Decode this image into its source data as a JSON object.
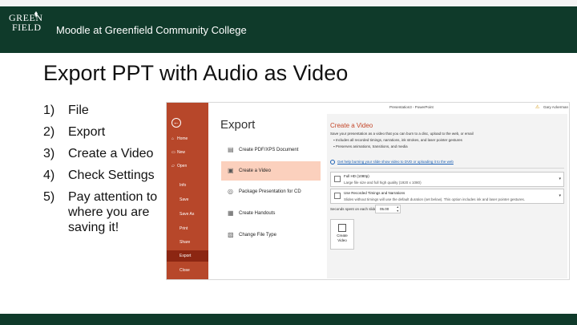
{
  "header": {
    "logo_top": "GREEN",
    "logo_bottom": "FIELD",
    "org_name": "Moodle at Greenfield Community College"
  },
  "slide": {
    "title": "Export PPT with Audio as Video",
    "steps": [
      {
        "num": "1)",
        "text": "File"
      },
      {
        "num": "2)",
        "text": "Export"
      },
      {
        "num": "3)",
        "text": "Create a Video"
      },
      {
        "num": "4)",
        "text": "Check Settings"
      },
      {
        "num": "5)",
        "text": "Pay attention to where you are saving it!"
      }
    ]
  },
  "ppt": {
    "app_title": "Presentation3 - PowerPoint",
    "user_name": "Gary Ackerman",
    "sidebar": [
      {
        "label": "Home",
        "icon": "⌂"
      },
      {
        "label": "New",
        "icon": "▭"
      },
      {
        "label": "Open",
        "icon": "▱"
      },
      {
        "label": "Info"
      },
      {
        "label": "Save"
      },
      {
        "label": "Save As"
      },
      {
        "label": "Print"
      },
      {
        "label": "Share"
      },
      {
        "label": "Export"
      },
      {
        "label": "Close"
      }
    ],
    "export_heading": "Export",
    "options": [
      {
        "label": "Create PDF/XPS Document",
        "icon": "▤"
      },
      {
        "label": "Create a Video",
        "icon": "▣"
      },
      {
        "label": "Package Presentation for CD",
        "icon": "◎"
      },
      {
        "label": "Create Handouts",
        "icon": "▦"
      },
      {
        "label": "Change File Type",
        "icon": "▧"
      }
    ],
    "detail": {
      "title": "Create a Video",
      "description": "Save your presentation as a video that you can burn to a disc, upload to the web, or email",
      "bullets": [
        "Includes all recorded timings, narrations, ink strokes, and laser pointer gestures",
        "Preserves animations, transitions, and media"
      ],
      "link": "Get help burning your slide show video to DVD or uploading it to the web",
      "quality_main": "Full HD (1080p)",
      "quality_sub": "Large file size and full high quality (1920 x 1080)",
      "timing_main": "Use Recorded Timings and Narrations",
      "timing_sub": "Slides without timings will use the default duration (set below). This option includes ink and laser pointer gestures.",
      "seconds_label": "Seconds spent on each slide:",
      "seconds_value": "05.00",
      "create_button_line1": "Create",
      "create_button_line2": "Video"
    },
    "colors": {
      "sidebar": "#b7472a",
      "sidebar_active": "#8c2612",
      "selected_option": "#fbd0bd",
      "accent_title": "#c4472a"
    }
  },
  "colors": {
    "brand_green": "#0f3a2a"
  }
}
